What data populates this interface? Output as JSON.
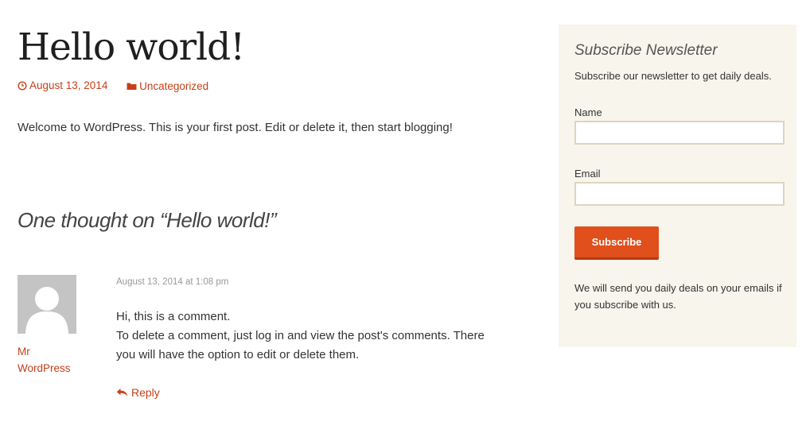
{
  "post": {
    "title": "Hello world!",
    "date": "August 13, 2014",
    "category": "Uncategorized",
    "content": "Welcome to WordPress. This is your first post. Edit or delete it, then start blogging!"
  },
  "comments": {
    "title": "One thought on “Hello world!”",
    "items": [
      {
        "author_line1": "Mr",
        "author_line2": "WordPress",
        "date": "August 13, 2014 at 1:08 pm",
        "line1": "Hi, this is a comment.",
        "line2": "To delete a comment, just log in and view the post's comments. There you will have the option to edit or delete them.",
        "reply": "Reply"
      }
    ]
  },
  "sidebar": {
    "title": "Subscribe Newsletter",
    "description": "Subscribe our newsletter to get daily deals.",
    "name_label": "Name",
    "name_value": "",
    "email_label": "Email",
    "email_value": "",
    "button": "Subscribe",
    "footer": "We will send you daily deals on your emails if you subscribe with us."
  },
  "icons": {
    "date": "clock-icon",
    "category": "folder-icon",
    "reply": "reply-arrow-icon",
    "avatar": "default-user-avatar"
  },
  "colors": {
    "accent": "#c5401a",
    "button": "#e04f1c",
    "sidebar_bg": "#f8f5ec",
    "input_border": "#dcd6bf"
  }
}
